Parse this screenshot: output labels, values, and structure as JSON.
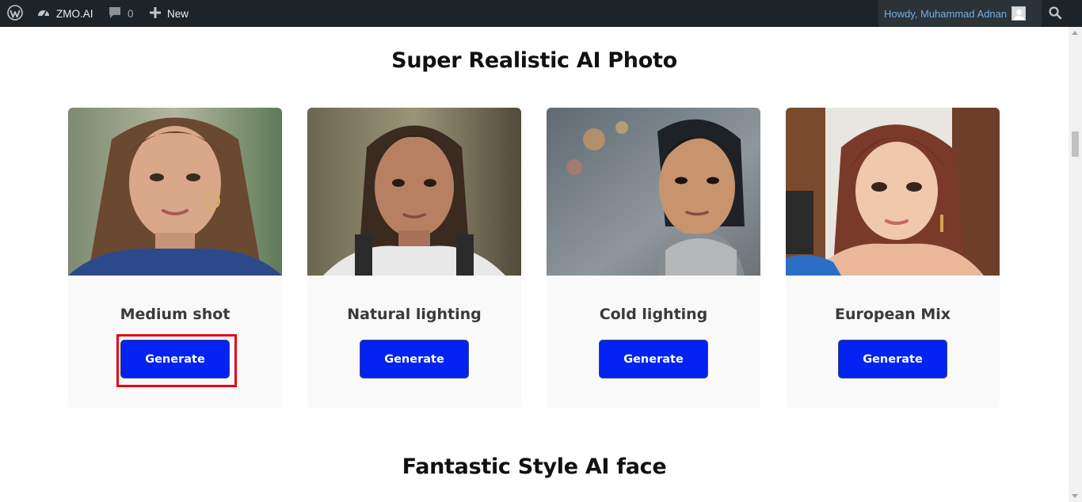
{
  "adminbar": {
    "site_name": "ZMO.AI",
    "comments_count": "0",
    "new_label": "New",
    "greeting": "Howdy, Muhammad Adnan",
    "icons": [
      "wordpress-logo-icon",
      "dashboard-icon",
      "comment-icon",
      "plus-icon",
      "avatar",
      "search-icon"
    ]
  },
  "sections": {
    "realistic_title": "Super Realistic AI Photo",
    "fantastic_title": "Fantastic Style AI face"
  },
  "cards": [
    {
      "title": "Medium shot",
      "button": "Generate",
      "highlighted": true
    },
    {
      "title": "Natural lighting",
      "button": "Generate",
      "highlighted": false
    },
    {
      "title": "Cold lighting",
      "button": "Generate",
      "highlighted": false
    },
    {
      "title": "European Mix",
      "button": "Generate",
      "highlighted": false
    }
  ],
  "colors": {
    "adminbar_bg": "#1d2327",
    "button_bg": "#0422f2",
    "highlight_border": "#e50914",
    "greeting_link": "#72aee6"
  }
}
